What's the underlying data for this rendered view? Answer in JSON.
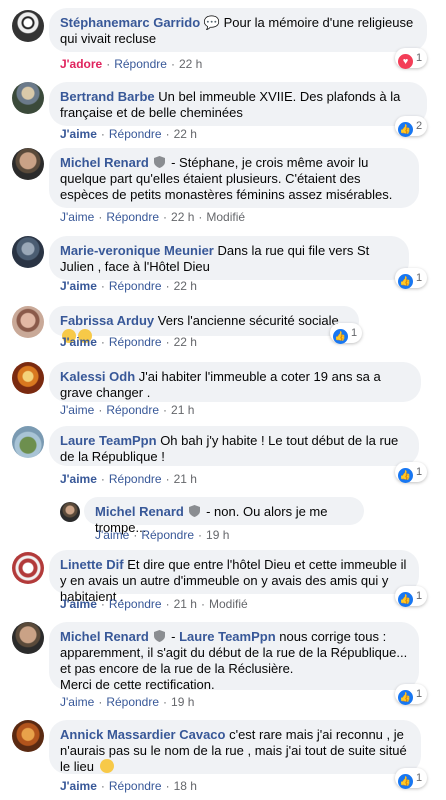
{
  "comments": [
    {
      "name": "Stéphanemarc Garrido",
      "text": "💬 Pour la mémoire d'une religieuse qui vivait recluse",
      "action1": "J'adore",
      "reply": "Répondre",
      "time": "22 h",
      "reaction_count": "1",
      "reaction": "love"
    },
    {
      "name": "Bertrand Barbe",
      "text": "Un bel immeuble XVIIE. Des plafonds à la française et de belle cheminées",
      "action1": "J'aime",
      "reply": "Répondre",
      "time": "22 h",
      "reaction_count": "2",
      "reaction": "like"
    },
    {
      "name": "Michel Renard",
      "text": "- Stéphane, je crois même avoir lu quelque part qu'elles étaient plusieurs. C'étaient des espèces de petits monastères féminins assez misérables.",
      "action1": "J'aime",
      "reply": "Répondre",
      "time": "22 h",
      "modified": "Modifié"
    },
    {
      "name": "Marie-veronique Meunier",
      "text": "Dans la rue qui file vers St Julien , face à l'Hôtel Dieu",
      "action1": "J'aime",
      "reply": "Répondre",
      "time": "22 h",
      "reaction_count": "1",
      "reaction": "like"
    },
    {
      "name": "Fabrissa Arduy",
      "text": "Vers l'ancienne sécurité sociale",
      "action1": "J'aime",
      "reply": "Répondre",
      "time": "22 h",
      "reaction_count": "1",
      "reaction": "like"
    },
    {
      "name": "Kalessi Odh",
      "text": "J'ai habiter l'immeuble a coter 19 ans sa a grave changer .",
      "action1": "J'aime",
      "reply": "Répondre",
      "time": "21 h"
    },
    {
      "name": "Laure TeamPpn",
      "text": "Oh bah j'y habite ! Le tout début de la rue de la République !",
      "action1": "J'aime",
      "reply": "Répondre",
      "time": "21 h",
      "reaction_count": "1",
      "reaction": "like"
    },
    {
      "name": "Michel Renard",
      "text": "- non. Ou alors je me trompe...",
      "action1": "J'aime",
      "reply": "Répondre",
      "time": "19 h"
    },
    {
      "name": "Linette Dif",
      "text": "Et dire que entre l'hôtel Dieu et cette immeuble il y en avais un autre d'immeuble on y avais des amis qui y habitaient .",
      "action1": "J'aime",
      "reply": "Répondre",
      "time": "21 h",
      "modified": "Modifié",
      "reaction_count": "1",
      "reaction": "like"
    },
    {
      "name": "Michel Renard",
      "mention": "Laure TeamPpn",
      "text": "nous corrige tous : apparemment, il s'agit du début de la rue de la République... et pas encore de la rue de la Réclusière.",
      "text2": "Merci de cette rectification.",
      "action1": "J'aime",
      "reply": "Répondre",
      "time": "19 h",
      "reaction_count": "1",
      "reaction": "like"
    },
    {
      "name": "Annick Massardier Cavaco",
      "text": "c'est rare mais j'ai reconnu , je n'aurais pas su le nom de la rue , mais j'ai tout de suite situé le lieu",
      "action1": "J'aime",
      "reply": "Répondre",
      "time": "18 h",
      "reaction_count": "1",
      "reaction": "like"
    }
  ],
  "colors": {
    "name": "#385898",
    "bubble": "#f0f2f5",
    "meta": "#65676b",
    "like": "#1877f2",
    "love": "#f33e58"
  }
}
